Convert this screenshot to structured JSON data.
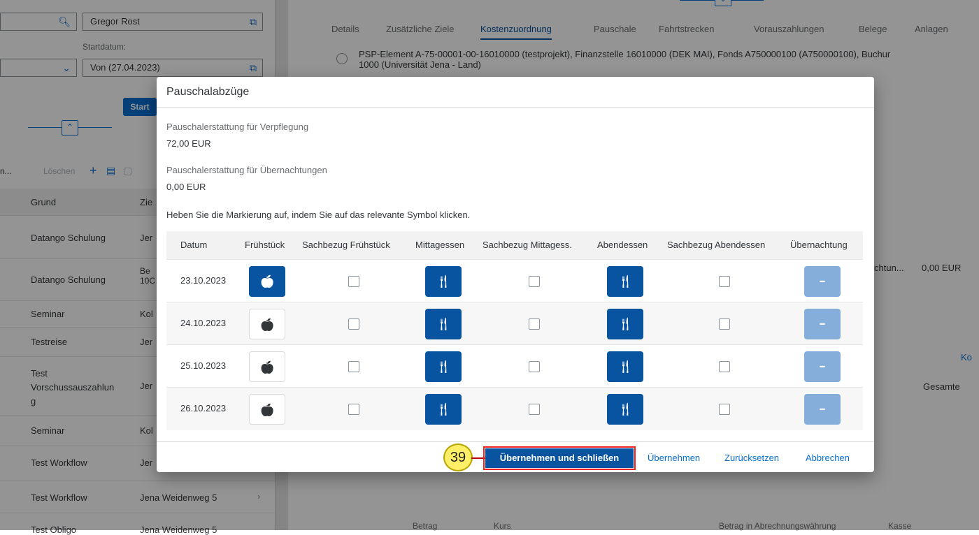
{
  "left_panel": {
    "search_value": "Gregor Rost",
    "startdatum_label": "Startdatum:",
    "startdatum_value": "Von (27.04.2023)",
    "start_button": "Start",
    "toolbar": {
      "truncated": "n...",
      "delete": "Löschen"
    },
    "header": {
      "c1": "Grund",
      "c2": "Zie"
    },
    "rows": [
      {
        "c1": "Datango Schulung",
        "c2": "Jer"
      },
      {
        "c1": "Datango Schulung",
        "c2": "Be 10C"
      },
      {
        "c1": "Seminar",
        "c2": "Kol"
      },
      {
        "c1": "Testreise",
        "c2": "Jer"
      },
      {
        "c1": "Test Vorschussauszahlun g",
        "c2": "Jer"
      },
      {
        "c1": "Seminar",
        "c2": "Kol"
      },
      {
        "c1": "Test Workflow",
        "c2": "Jer"
      },
      {
        "c1": "Test Workflow",
        "c2": "Jena Weidenweg 5"
      },
      {
        "c1": "Test Obligo",
        "c2": "Jena Weidenweg 5"
      }
    ]
  },
  "right_panel": {
    "tabs": [
      "Details",
      "Zusätzliche Ziele",
      "Kostenzuordnung",
      "Pauschale",
      "Fahrtstrecken",
      "Vorauszahlungen",
      "Belege",
      "Anlagen"
    ],
    "active_tab": "Kostenzuordnung",
    "psp_line1": "PSP-Element A-75-00001-00-16010000 (testprojekt), Finanzstelle 16010000 (DEK MAI), Fonds A750000100 (A750000100), Buchur",
    "psp_line2": "1000 (Universität Jena - Land)",
    "side_text1": "chtun...",
    "side_text2": "0,00 EUR",
    "side_text3": "Ko",
    "side_text4": "Gesamte",
    "bottom_headers": [
      "Betrag",
      "Kurs",
      "Betrag in Abrechnungswährung",
      "Kasse"
    ]
  },
  "dialog": {
    "title": "Pauschalabzüge",
    "meal_label": "Pauschalerstattung für Verpflegung",
    "meal_value": "72,00  EUR",
    "night_label": "Pauschalerstattung für Übernachtungen",
    "night_value": "0,00  EUR",
    "hint": "Heben Sie die Markierung auf, indem Sie auf das relevante Symbol klicken.",
    "columns": [
      "Datum",
      "Frühstück",
      "Sachbezug Frühstück",
      "Mittagessen",
      "Sachbezug Mittagess.",
      "Abendessen",
      "Sachbezug Abendessen",
      "Übernachtung"
    ],
    "rows": [
      {
        "date": "23.10.2023",
        "breakfast": true
      },
      {
        "date": "24.10.2023",
        "breakfast": false
      },
      {
        "date": "25.10.2023",
        "breakfast": false
      },
      {
        "date": "26.10.2023",
        "breakfast": false
      }
    ],
    "icons": {
      "breakfast": "apple-icon",
      "meal": "cutlery-icon",
      "night": "bed-icon"
    },
    "footer": {
      "badge": "39",
      "primary": "Übernehmen und schließen",
      "apply": "Übernehmen",
      "reset": "Zurücksetzen",
      "cancel": "Abbrechen"
    }
  }
}
